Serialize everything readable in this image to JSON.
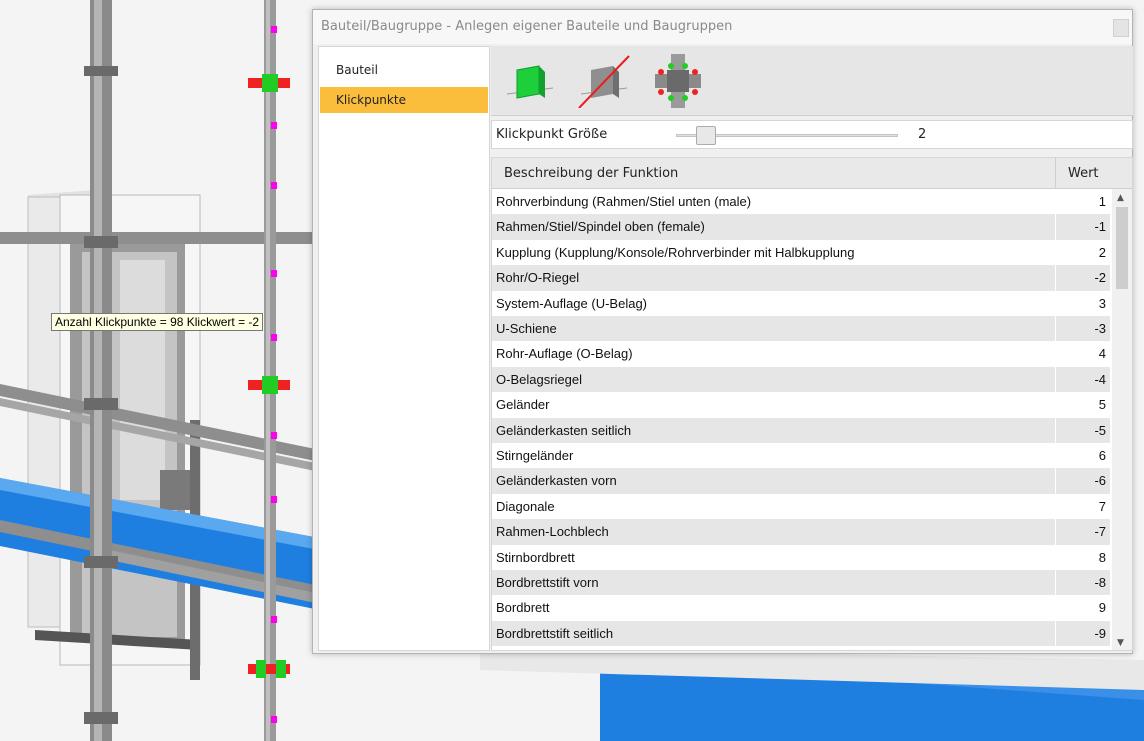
{
  "tooltip": {
    "text": "Anzahl Klickpunkte = 98  Klickwert = -2"
  },
  "dialog": {
    "title": "Bauteil/Baugruppe - Anlegen eigener Bauteile und Baugruppen",
    "close_icon": "close-icon"
  },
  "nav": {
    "items": [
      {
        "label": "Bauteil",
        "active": false
      },
      {
        "label": "Klickpunkte",
        "active": true
      }
    ]
  },
  "toolbar": {
    "buttons": [
      {
        "icon": "plane-add-icon"
      },
      {
        "icon": "plane-remove-icon"
      },
      {
        "icon": "clickpoints-pipe-icon"
      }
    ]
  },
  "size": {
    "label": "Klickpunkt Größe",
    "value": "2",
    "slider_fraction": 0.1
  },
  "table": {
    "columns": [
      "Beschreibung der Funktion",
      "Wert"
    ],
    "rows": [
      {
        "desc": "Rohrverbindung (Rahmen/Stiel unten (male)",
        "value": "1"
      },
      {
        "desc": "Rahmen/Stiel/Spindel oben (female)",
        "value": "-1"
      },
      {
        "desc": "Kupplung (Kupplung/Konsole/Rohrverbinder mit Halbkupplung",
        "value": "2"
      },
      {
        "desc": "Rohr/O-Riegel",
        "value": "-2"
      },
      {
        "desc": "System-Auflage (U-Belag)",
        "value": "3"
      },
      {
        "desc": "U-Schiene",
        "value": "-3"
      },
      {
        "desc": "Rohr-Auflage (O-Belag)",
        "value": "4"
      },
      {
        "desc": "O-Belagsriegel",
        "value": "-4"
      },
      {
        "desc": "Geländer",
        "value": "5"
      },
      {
        "desc": "Geländerkasten seitlich",
        "value": "-5"
      },
      {
        "desc": "Stirngeländer",
        "value": "6"
      },
      {
        "desc": "Geländerkasten vorn",
        "value": "-6"
      },
      {
        "desc": "Diagonale",
        "value": "7"
      },
      {
        "desc": "Rahmen-Lochblech",
        "value": "-7"
      },
      {
        "desc": "Stirnbordbrett",
        "value": "8"
      },
      {
        "desc": "Bordbrettstift vorn",
        "value": "-8"
      },
      {
        "desc": "Bordbrett",
        "value": "9"
      },
      {
        "desc": "Bordbrettstift seitlich",
        "value": "-9"
      }
    ]
  },
  "colors": {
    "active_nav": "#fbbd3c",
    "click_green": "#22cc22",
    "click_red": "#ee2222",
    "marker_magenta": "#ff00ee",
    "water_blue": "#1e7fe0"
  }
}
